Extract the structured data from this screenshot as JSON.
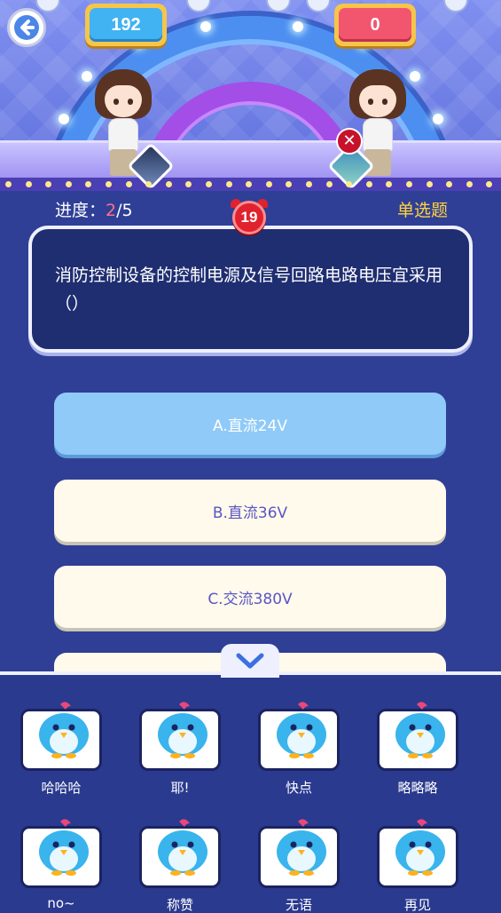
{
  "scores": {
    "player": "192",
    "opponent": "0"
  },
  "progress": {
    "label": "进度：",
    "current": "2",
    "total": "/5"
  },
  "timer": "19",
  "question_type": "单选题",
  "question": "消防控制设备的控制电源及信号回路电路电压宜采用（）",
  "options": [
    {
      "label": "A.直流24V",
      "selected": true
    },
    {
      "label": "B.直流36V",
      "selected": false
    },
    {
      "label": "C.交流380V",
      "selected": false
    }
  ],
  "emojis": [
    "哈哈哈",
    "耶!",
    "快点",
    "略略略",
    "no~",
    "称赞",
    "无语",
    "再见"
  ],
  "opponent_status": "✕",
  "colors": {
    "background": "#2f3f96",
    "player_score": "#41b3f2",
    "opponent_score": "#f2566f",
    "selected_option": "#8fcaf8",
    "question_type": "#ffd23c",
    "timer": "#e0222f"
  }
}
